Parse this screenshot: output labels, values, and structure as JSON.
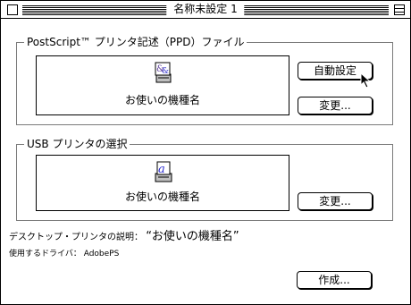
{
  "window": {
    "title": "名称未設定 1"
  },
  "ppd_section": {
    "title": "PostScript™ プリンタ記述（PPD）ファイル",
    "printer_name": "お使いの機種名",
    "auto_setup_button": "自動設定",
    "change_button": "変更..."
  },
  "usb_section": {
    "title": "USB プリンタの選択",
    "printer_name": "お使いの機種名",
    "change_button": "変更..."
  },
  "info": {
    "desktop_printer_label": "デスクトップ・プリンタの説明：",
    "desktop_printer_value": "“お使いの機種名”",
    "driver_label": "使用するドライバ：",
    "driver_value": "AdobePS"
  },
  "create_button": "作成..."
}
